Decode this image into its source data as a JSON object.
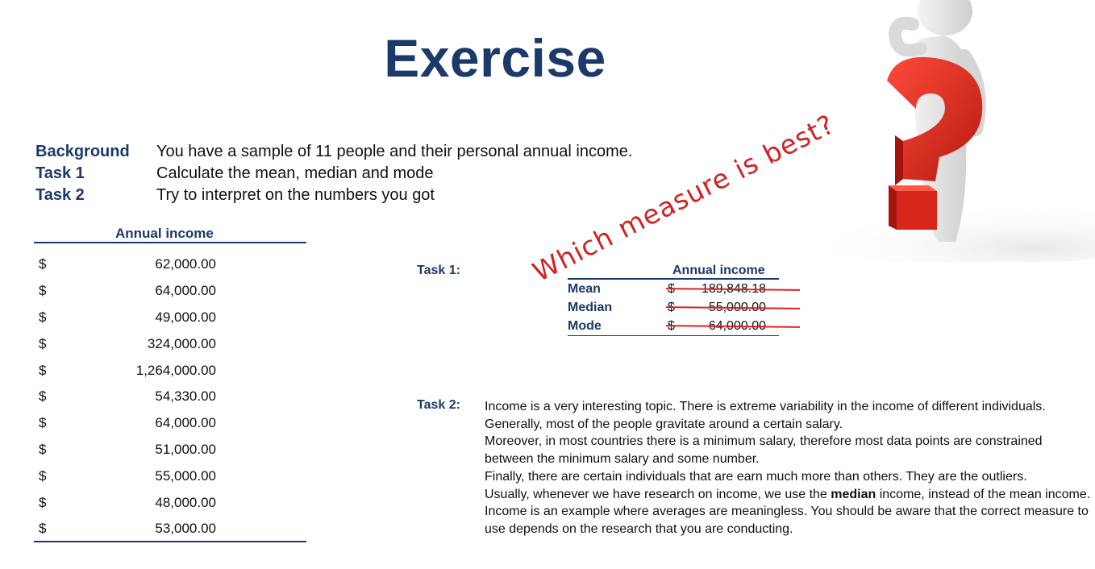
{
  "title": "Exercise",
  "intro": [
    {
      "label": "Background",
      "text": "You have a sample of 11 people and their personal annual income."
    },
    {
      "label": "Task 1",
      "text": "Calculate the mean, median and mode"
    },
    {
      "label": "Task 2",
      "text": "Try to interpret on the numbers you got"
    }
  ],
  "income_table": {
    "header": "Annual income",
    "currency": "$",
    "values": [
      "62,000.00",
      "64,000.00",
      "49,000.00",
      "324,000.00",
      "1,264,000.00",
      "54,330.00",
      "64,000.00",
      "51,000.00",
      "55,000.00",
      "48,000.00",
      "53,000.00"
    ]
  },
  "task1": {
    "label": "Task 1:",
    "header": "Annual income",
    "rows": [
      {
        "name": "Mean",
        "currency": "$",
        "value": "189,848.18"
      },
      {
        "name": "Median",
        "currency": "$",
        "value": "55,000.00"
      },
      {
        "name": "Mode",
        "currency": "$",
        "value": "64,000.00"
      }
    ],
    "annotation": "Which measure is best?",
    "annotation_color": "#d02222"
  },
  "task2": {
    "label": "Task 2:",
    "p1": "Income is a very interesting topic. There is extreme variability in the income of different individuals.",
    "p2": "Generally, most of the people gravitate around a certain salary.",
    "p3": "Moreover, in most countries there is a minimum salary, therefore most data points are constrained between the minimum salary and some number.",
    "p4": "Finally, there are certain individuals that are earn much more than others. They are the outliers.",
    "p5_before": "Usually, whenever we have research on income, we use the ",
    "p5_bold": "median",
    "p5_after": " income, instead of the mean income.",
    "p6": "Income is an example where averages are meaningless. You should be aware that the correct measure to use depends on the research that you are conducting."
  },
  "colors": {
    "navy": "#1b3a6b",
    "red": "#d02222"
  },
  "figure": {
    "icon": "thinking-figure-question-mark-icon"
  }
}
